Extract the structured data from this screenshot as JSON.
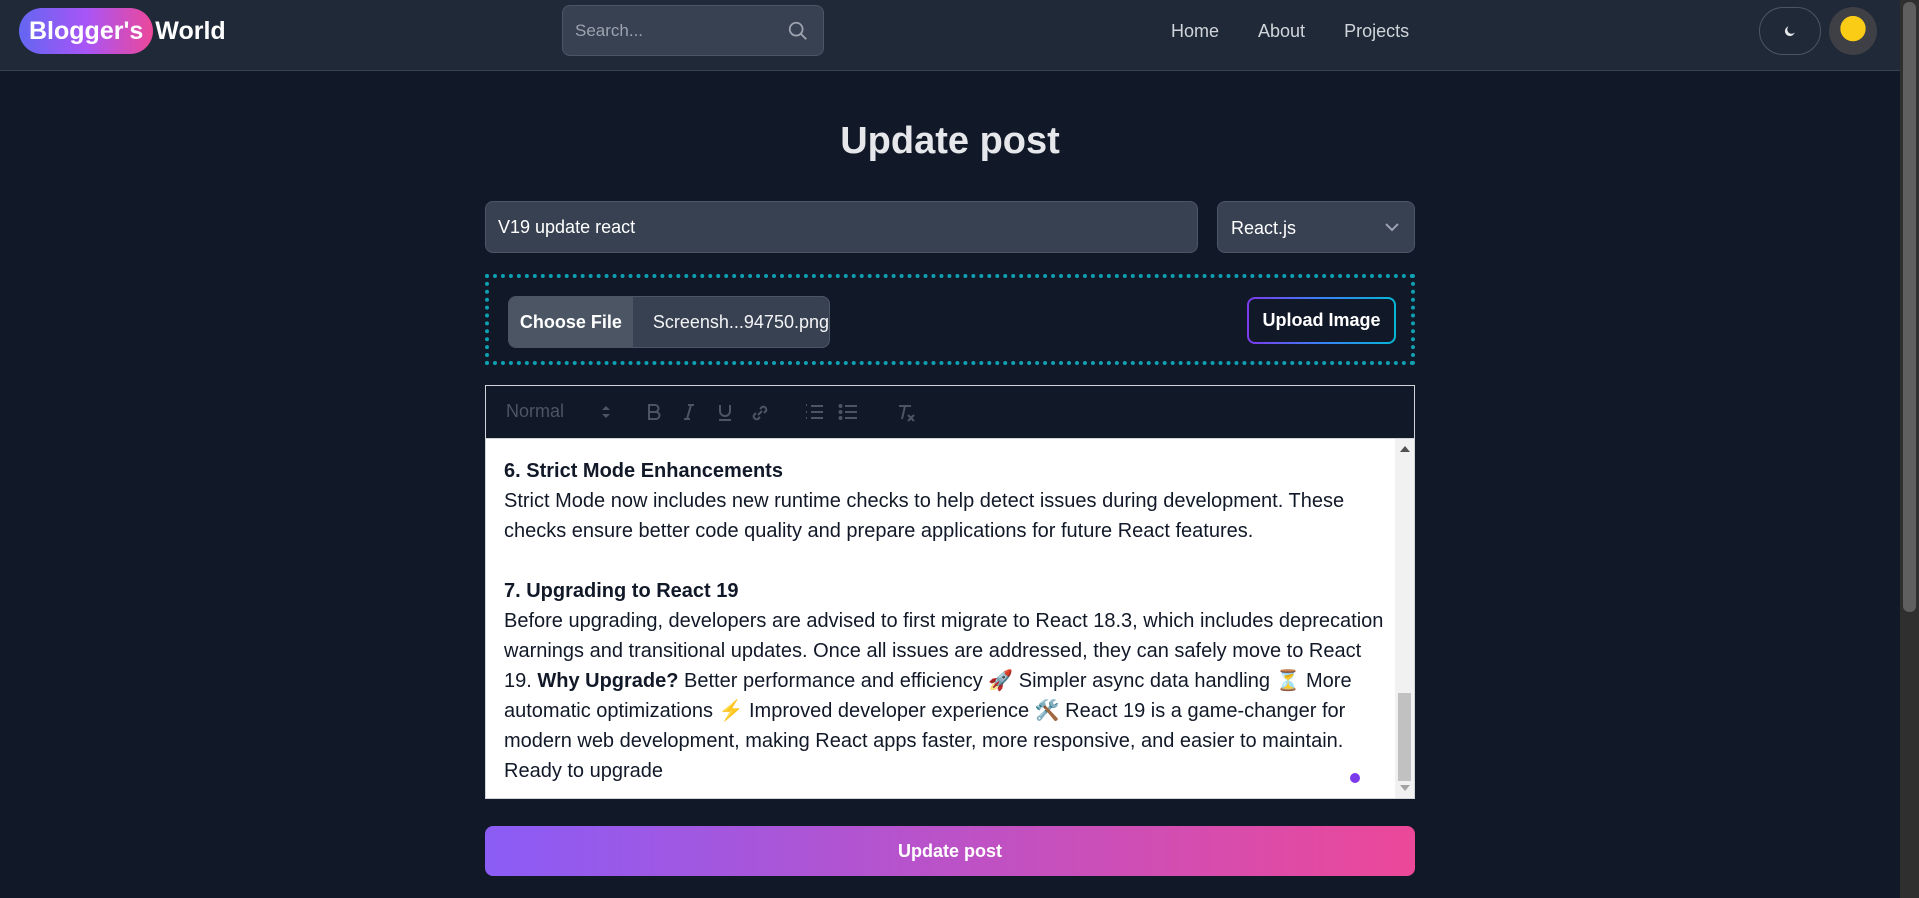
{
  "header": {
    "logo_pill": "Blogger's",
    "logo_rest": "World",
    "search_placeholder": "Search...",
    "nav": [
      "Home",
      "About",
      "Projects"
    ],
    "theme_icon": "moon-icon",
    "avatar": "user-avatar"
  },
  "main": {
    "title": "Update post",
    "post_title_value": "V19 update react",
    "category_value": "React.js",
    "file_button": "Choose File",
    "file_name": "Screensh...94750.png",
    "upload_button": "Upload Image",
    "toolbar": {
      "format": "Normal",
      "icons": [
        "bold-icon",
        "italic-icon",
        "underline-icon",
        "link-icon",
        "ordered-list-icon",
        "bullet-list-icon",
        "clear-format-icon"
      ]
    },
    "editor": {
      "h6": "6. Strict Mode Enhancements",
      "p6": "Strict Mode now includes new runtime checks to help detect issues during development. These checks ensure better code quality and prepare applications for future React features.",
      "h7": "7. Upgrading to React 19",
      "p7a": "Before upgrading, developers are advised to first migrate to React 18.3, which includes deprecation warnings and transitional updates. Once all issues are addressed, they can safely move to React 19. ",
      "p7_bold": "Why Upgrade?",
      "p7b": " Better performance and efficiency 🚀 Simpler async data handling ⏳ More automatic optimizations ⚡ Improved developer experience 🛠️ React 19 is a game-changer for modern web development, making React apps faster, more responsive, and easier to maintain. Ready to upgrade"
    },
    "submit": "Update post"
  },
  "colors": {
    "background": "#111827",
    "navbar": "#1f2937",
    "gradient_start": "#8b5cf6",
    "gradient_end": "#ec4899",
    "dotted_border": "#0e9fb0"
  }
}
